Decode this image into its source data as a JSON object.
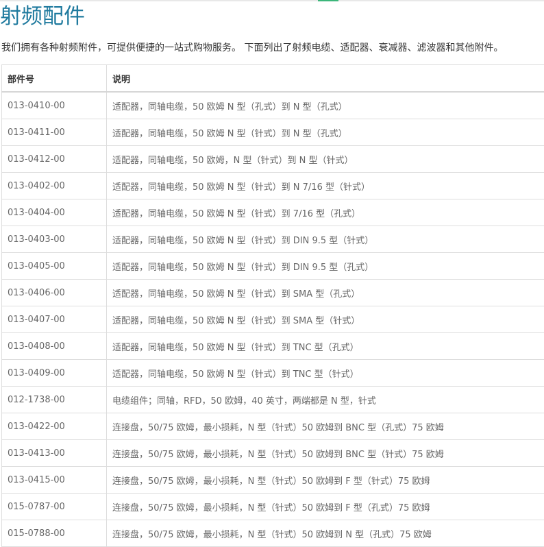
{
  "page": {
    "title": "射频配件",
    "intro": "我们拥有各种射频附件，可提供便捷的一站式购物服务。 下面列出了射频电缆、适配器、衰减器、滤波器和其他附件。"
  },
  "table": {
    "headers": [
      "部件号",
      "说明"
    ],
    "rows": [
      {
        "part": "013-0410-00",
        "desc": "适配器，同轴电缆，50 欧姆 N 型（孔式）到 N 型（孔式）"
      },
      {
        "part": "013-0411-00",
        "desc": "适配器，同轴电缆，50 欧姆 N 型（针式）到 N 型（孔式）"
      },
      {
        "part": "013-0412-00",
        "desc": "适配器，同轴电缆，50 欧姆，N 型（针式）到 N 型（针式）"
      },
      {
        "part": "013-0402-00",
        "desc": "适配器，同轴电缆，50 欧姆 N 型（针式）到 N 7/16 型（针式）"
      },
      {
        "part": "013-0404-00",
        "desc": "适配器，同轴电缆，50 欧姆 N 型（针式）到 7/16 型（孔式）"
      },
      {
        "part": "013-0403-00",
        "desc": "适配器，同轴电缆，50 欧姆 N 型（针式）到 DIN 9.5 型（针式）"
      },
      {
        "part": "013-0405-00",
        "desc": "适配器，同轴电缆，50 欧姆 N 型（针式）到 DIN 9.5 型（孔式）"
      },
      {
        "part": "013-0406-00",
        "desc": "适配器，同轴电缆，50 欧姆 N 型（针式）到 SMA 型（孔式）"
      },
      {
        "part": "013-0407-00",
        "desc": "适配器，同轴电缆，50 欧姆 N 型（针式）到 SMA 型（针式）"
      },
      {
        "part": "013-0408-00",
        "desc": "适配器，同轴电缆，50 欧姆 N 型（针式）到 TNC 型（孔式）"
      },
      {
        "part": "013-0409-00",
        "desc": "适配器，同轴电缆，50 欧姆 N 型（针式）到 TNC 型（针式）"
      },
      {
        "part": "012-1738-00",
        "desc": "电缆组件；同轴，RFD，50 欧姆，40 英寸，两端都是 N 型，针式"
      },
      {
        "part": "013-0422-00",
        "desc": "连接盘，50/75 欧姆，最小损耗，N 型（针式）50 欧姆到 BNC 型（孔式）75 欧姆"
      },
      {
        "part": "013-0413-00",
        "desc": "连接盘，50/75 欧姆，最小损耗，N 型（针式）50 欧姆到 BNC 型（针式）75 欧姆"
      },
      {
        "part": "013-0415-00",
        "desc": "连接盘，50/75 欧姆，最小损耗，N 型（针式）50 欧姆到 F 型（针式）75 欧姆"
      },
      {
        "part": "015-0787-00",
        "desc": "连接盘，50/75 欧姆，最小损耗，N 型（针式）50 欧姆到 F 型（孔式）75 欧姆"
      },
      {
        "part": "015-0788-00",
        "desc": "连接盘，50/75 欧姆，最小损耗，N 型（针式）50 欧姆到 N 型（孔式）75 欧姆"
      }
    ]
  },
  "colors": {
    "title": "#1f7a9e",
    "accent": "#3cb67a",
    "border": "#dddddd"
  }
}
